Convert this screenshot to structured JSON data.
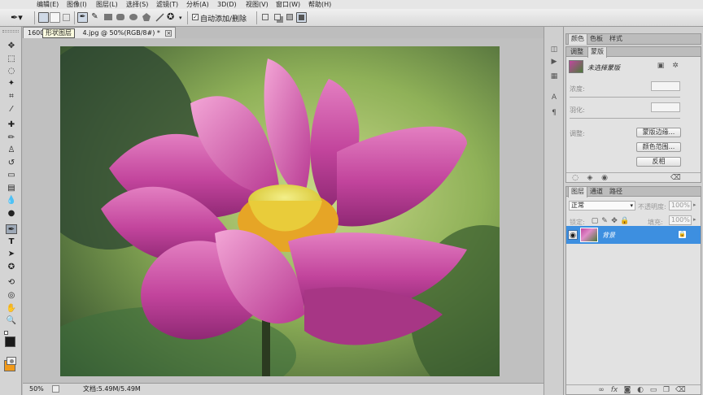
{
  "menu": [
    "编辑(E)",
    "图像(I)",
    "图层(L)",
    "选择(S)",
    "滤镜(T)",
    "分析(A)",
    "3D(D)",
    "视图(V)",
    "窗口(W)",
    "帮助(H)"
  ],
  "options": {
    "tooltip": "形状图层",
    "auto_add_delete_label": "自动添加/删除",
    "auto_add_delete_checked": true
  },
  "document": {
    "tab_title": "1600_______4.jpg @ 50%(RGB/8#) *",
    "tab_title_prefix": "1600",
    "tab_title_suffix": "4.jpg @ 50%(RGB/8#) *",
    "zoom": "50%",
    "doc_size": "文档:5.49M/5.49M"
  },
  "colors": {
    "foreground": "#1a1a1a",
    "background": "#f19a1a",
    "selection_blue": "#3d8fe0"
  },
  "panels": {
    "color_group_tabs": [
      "颜色",
      "色板",
      "样式"
    ],
    "adjust_group_tabs": [
      "调整",
      "蒙版"
    ],
    "mask_title": "未选择蒙版",
    "density_label": "浓度:",
    "feather_label": "羽化:",
    "refine_label": "调整:",
    "mask_edge_button": "蒙版边缘...",
    "color_range_button": "颜色范围...",
    "invert_button": "反相",
    "layers_tabs": [
      "图层",
      "通道",
      "路径"
    ],
    "blend_mode": "正常",
    "opacity_label": "不透明度:",
    "opacity_value": "100%",
    "lock_label": "锁定:",
    "fill_label": "填充:",
    "fill_value": "100%",
    "layer_name": "背景"
  }
}
